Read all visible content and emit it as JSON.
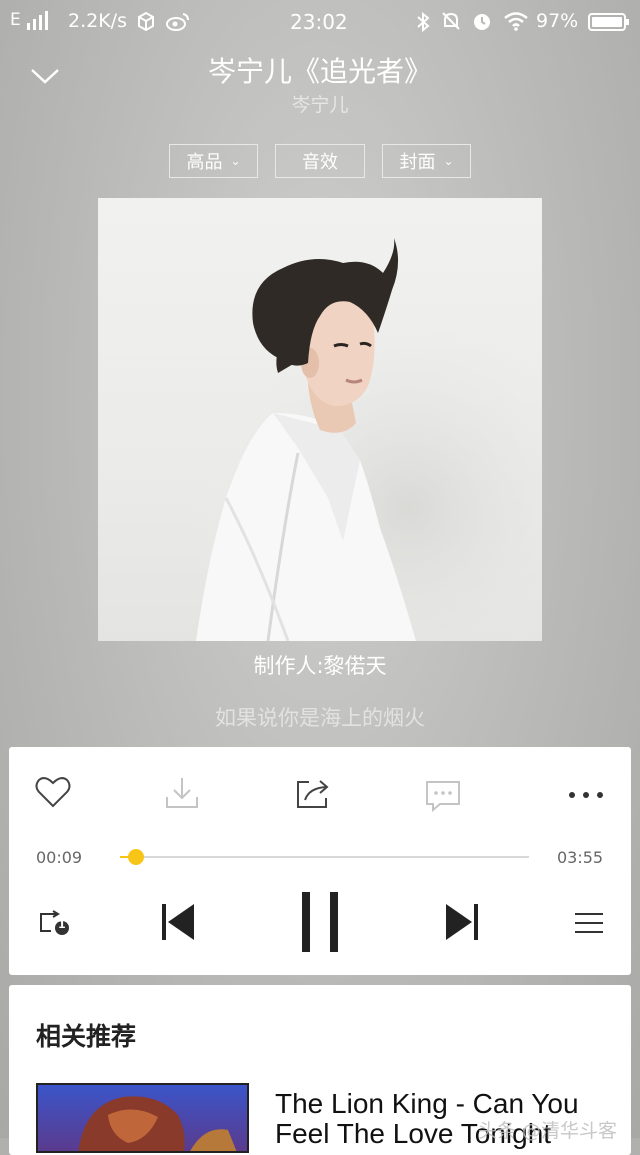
{
  "status_bar": {
    "network": "E",
    "speed": "2.2K/s",
    "time": "23:02",
    "battery": "97%"
  },
  "header": {
    "title": "岑宁儿《追光者》",
    "artist": "岑宁儿"
  },
  "chips": {
    "quality": "高品",
    "effects": "音效",
    "cover": "封面"
  },
  "info": {
    "producer": "制作人:黎偌天",
    "lyric": "如果说你是海上的烟火"
  },
  "player": {
    "elapsed": "00:09",
    "duration": "03:55",
    "progress": 0.04,
    "accent": "#f6c517",
    "queue_badge": "1"
  },
  "recommend": {
    "title": "相关推荐",
    "song": "The Lion King - Can You Feel The Love Tonight"
  },
  "watermark": "头条 @清华斗客"
}
